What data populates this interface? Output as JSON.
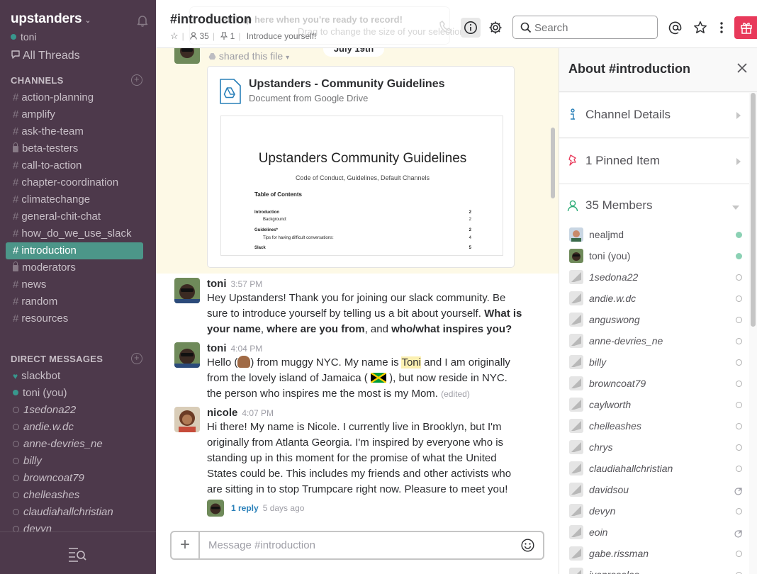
{
  "team": {
    "name": "upstanders",
    "user": "toni"
  },
  "all_threads": "All Threads",
  "channels": {
    "heading": "CHANNELS",
    "items": [
      {
        "label": "action-planning",
        "kind": "public"
      },
      {
        "label": "amplify",
        "kind": "public"
      },
      {
        "label": "ask-the-team",
        "kind": "public"
      },
      {
        "label": "beta-testers",
        "kind": "private"
      },
      {
        "label": "call-to-action",
        "kind": "public"
      },
      {
        "label": "chapter-coordination",
        "kind": "public"
      },
      {
        "label": "climatechange",
        "kind": "public"
      },
      {
        "label": "general-chit-chat",
        "kind": "public"
      },
      {
        "label": "how_do_we_use_slack",
        "kind": "public"
      },
      {
        "label": "introduction",
        "kind": "public",
        "active": true
      },
      {
        "label": "moderators",
        "kind": "private"
      },
      {
        "label": "news",
        "kind": "public"
      },
      {
        "label": "random",
        "kind": "public"
      },
      {
        "label": "resources",
        "kind": "public"
      }
    ]
  },
  "direct_messages": {
    "heading": "DIRECT MESSAGES",
    "items": [
      {
        "label": "slackbot",
        "presence": "bot"
      },
      {
        "label": "toni (you)",
        "presence": "online"
      },
      {
        "label": "1sedona22",
        "presence": "away"
      },
      {
        "label": "andie.w.dc",
        "presence": "away"
      },
      {
        "label": "anne-devries_ne",
        "presence": "away"
      },
      {
        "label": "billy",
        "presence": "away"
      },
      {
        "label": "browncoat79",
        "presence": "away"
      },
      {
        "label": "chelleashes",
        "presence": "away"
      },
      {
        "label": "claudiahallchristian",
        "presence": "away"
      },
      {
        "label": "devyn",
        "presence": "away"
      }
    ]
  },
  "header": {
    "channel_title": "#introduction",
    "member_count": "35",
    "pinned_count": "1",
    "topic": "Introduce yourself!",
    "overlay_line1": "Pull up here when you're ready to record!",
    "overlay_line2": "Drag to change the size of your selection",
    "search_placeholder": "Search"
  },
  "messages": {
    "date_divider": "July 19th",
    "file_share": {
      "action": "shared this file",
      "title": "Upstanders - Community Guidelines",
      "source": "Document from Google Drive",
      "preview": {
        "title": "Upstanders Community Guidelines",
        "subtitle": "Code of Conduct, Guidelines, Default Channels",
        "toc_heading": "Table of Contents",
        "toc": [
          {
            "label": "Introduction",
            "page": "2",
            "bold": true
          },
          {
            "label": "Background:",
            "page": "2",
            "bold": false
          },
          {
            "label": "Guidelines*",
            "page": "2",
            "bold": true
          },
          {
            "label": "Tips for having difficult conversations:",
            "page": "4",
            "bold": false
          },
          {
            "label": "Slack",
            "page": "5",
            "bold": true
          }
        ]
      }
    },
    "msg1": {
      "author": "toni",
      "time": "3:57 PM",
      "text_a": "Hey Upstanders! Thank you for joining our  slack community. Be sure to introduce yourself by telling us a bit about yourself. ",
      "bold_a": "What is your name",
      "text_b": ", ",
      "bold_b": "where are you from",
      "text_c": ", and ",
      "bold_c": "who/what inspires you?"
    },
    "msg2": {
      "author": "toni",
      "time": "4:04 PM",
      "text_a": "Hello (",
      "text_b": ")  from muggy NYC. My name is ",
      "highlight": "Toni",
      "text_c": " and I am originally from the lovely island of Jamaica (",
      "text_d": "), but now reside in NYC. the person who inspires me the most is my Mom. ",
      "edited": "(edited)"
    },
    "msg3": {
      "author": "nicole",
      "time": "4:07 PM",
      "text": "Hi there! My name is Nicole. I currently live in Brooklyn, but I'm originally from Atlanta Georgia. I'm inspired by everyone who is standing up in this moment for the promise of what the United States could be. This includes my friends and other activists who are sitting in to stop Trumpcare right now. Pleasure to meet you!",
      "reply_count": "1 reply",
      "reply_age": "5 days ago"
    }
  },
  "composer": {
    "placeholder": "Message #introduction"
  },
  "panel": {
    "title": "About #introduction",
    "channel_details": "Channel Details",
    "pinned": "1 Pinned Item",
    "members_heading": "35 Members",
    "members": [
      {
        "name": "nealjmd",
        "status": "online",
        "av": "photo"
      },
      {
        "name": "toni (you)",
        "status": "online",
        "av": "photo2"
      },
      {
        "name": "1sedona22",
        "status": "offline",
        "av": "grey"
      },
      {
        "name": "andie.w.dc",
        "status": "offline",
        "av": "grey"
      },
      {
        "name": "anguswong",
        "status": "offline",
        "av": "grey"
      },
      {
        "name": "anne-devries_ne",
        "status": "offline",
        "av": "grey"
      },
      {
        "name": "billy",
        "status": "offline",
        "av": "grey"
      },
      {
        "name": "browncoat79",
        "status": "offline",
        "av": "grey"
      },
      {
        "name": "caylworth",
        "status": "offline",
        "av": "grey"
      },
      {
        "name": "chelleashes",
        "status": "offline",
        "av": "grey"
      },
      {
        "name": "chrys",
        "status": "offline",
        "av": "grey"
      },
      {
        "name": "claudiahallchristian",
        "status": "offline",
        "av": "grey"
      },
      {
        "name": "davidsou",
        "status": "external",
        "av": "grey"
      },
      {
        "name": "devyn",
        "status": "offline",
        "av": "grey"
      },
      {
        "name": "eoin",
        "status": "external",
        "av": "grey"
      },
      {
        "name": "gabe.rissman",
        "status": "offline",
        "av": "grey"
      },
      {
        "name": "ivanrosales",
        "status": "offline",
        "av": "grey"
      }
    ]
  },
  "colors": {
    "sidebar": "#4d394b",
    "active_channel": "#4c9689",
    "presence": "#38978d",
    "gift": "#e8395a",
    "link": "#2a80b9"
  }
}
